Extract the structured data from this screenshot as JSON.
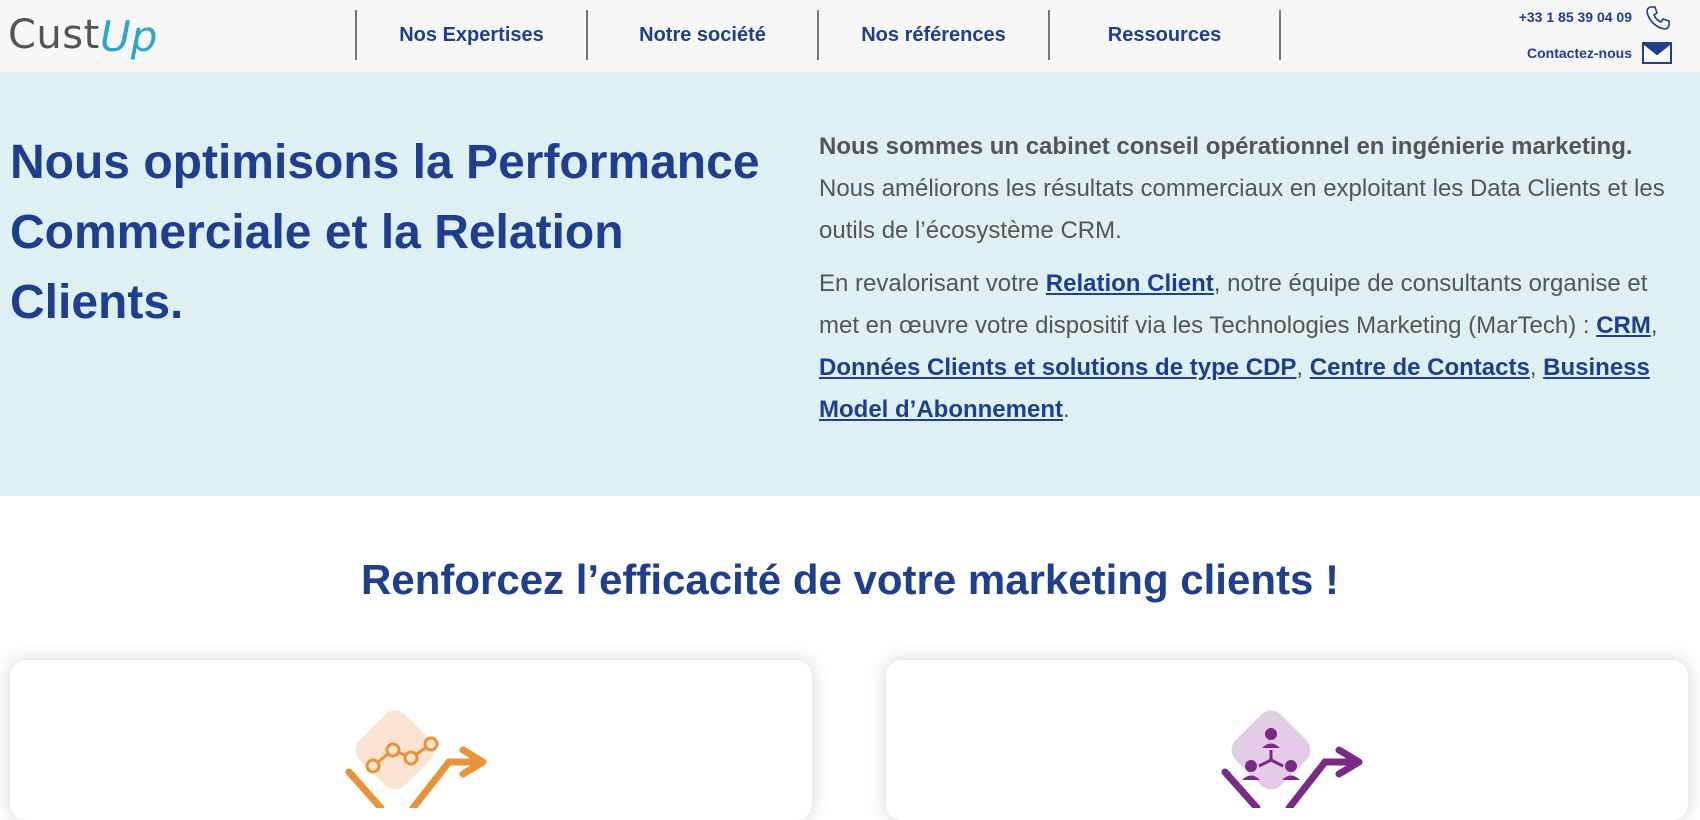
{
  "header": {
    "logo": {
      "part1": "Cust",
      "part2": "Up"
    },
    "nav": [
      {
        "label": "Nos Expertises"
      },
      {
        "label": "Notre société"
      },
      {
        "label": "Nos références"
      },
      {
        "label": "Ressources"
      }
    ],
    "phone": "+33 1 85 39 04 09",
    "contact_label": "Contactez-nous"
  },
  "hero": {
    "title": "Nous optimisons la Performance Commerciale et la Relation Clients.",
    "intro_bold": "Nous sommes un cabinet conseil opérationnel en ingénierie marketing.",
    "intro_rest": " Nous améliorons les résultats commerciaux en exploitant les Data Clients et les outils de l’écosystème CRM.",
    "p2_start": "En revalorisant votre ",
    "link_relation": "Relation Client",
    "p2_mid": ", notre équipe de consultants organise et met en œuvre votre dispositif via les Technologies Marketing (MarTech) : ",
    "link_crm": "CRM",
    "sep1": ", ",
    "link_cdp": "Données Clients et solutions de type CDP",
    "sep2": ", ",
    "link_contacts": "Centre de Contacts",
    "sep3": ", ",
    "link_abonnement": "Business Model d’Abonnement",
    "p2_end": "."
  },
  "section": {
    "title": "Renforcez l’efficacité de votre marketing clients !"
  },
  "cards": [
    {
      "icon": "performance-chart-icon",
      "accent": "#e8923a",
      "bg": "#fbe3d1"
    },
    {
      "icon": "customer-network-icon",
      "accent": "#7a2a86",
      "bg": "#e3cde6"
    }
  ],
  "colors": {
    "brand_blue": "#1e3f8f",
    "logo_cyan": "#2aa7c9",
    "hero_bg": "#dff0f4"
  }
}
